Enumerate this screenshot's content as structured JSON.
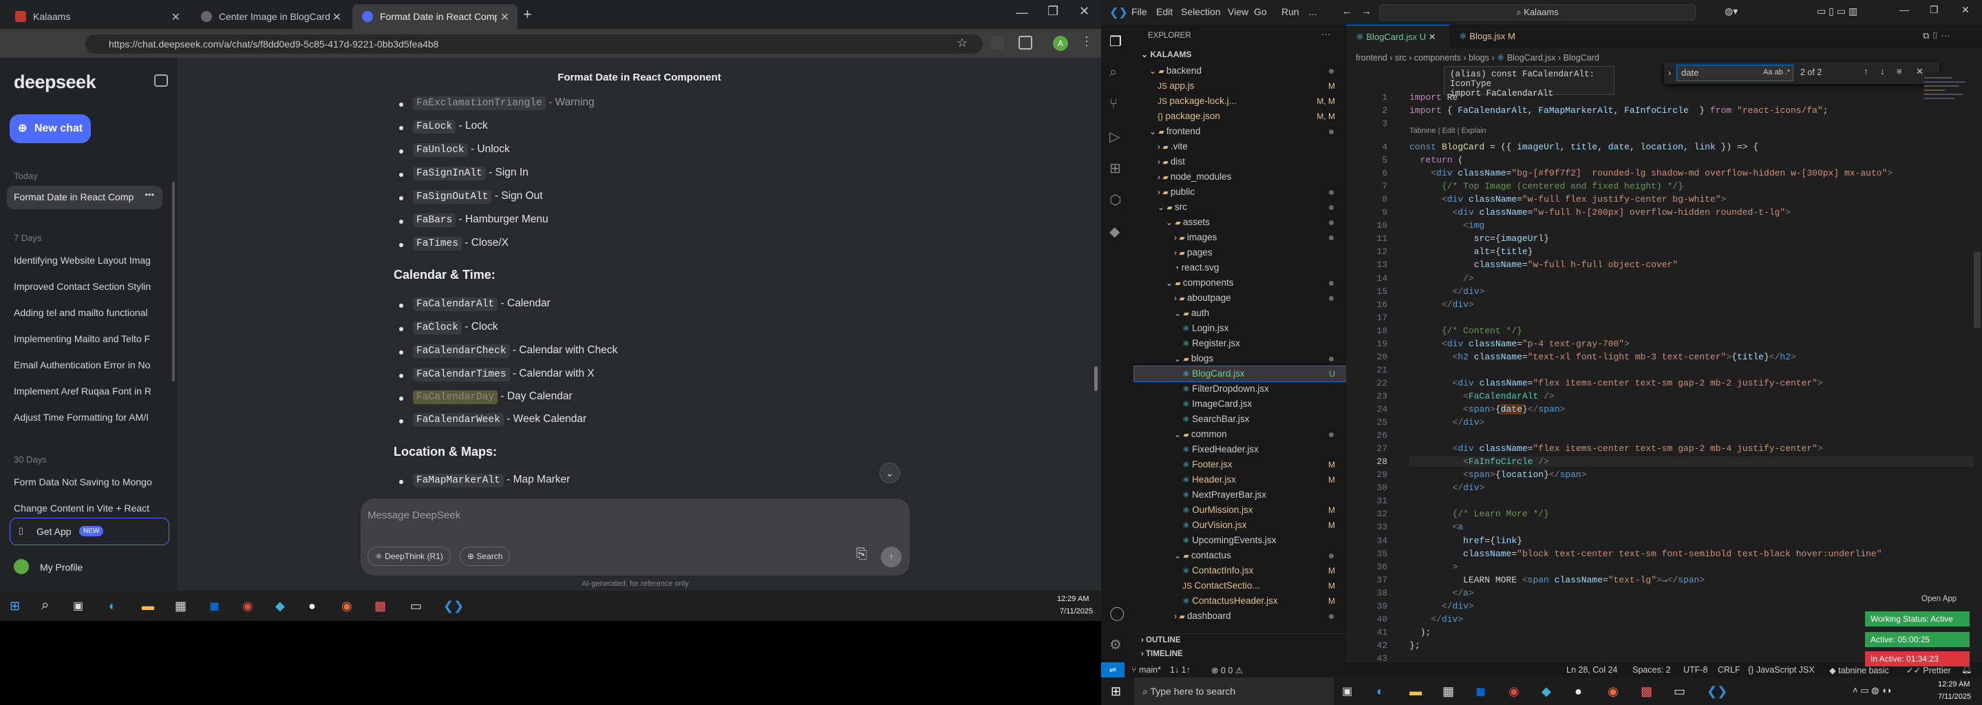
{
  "chrome": {
    "tabs": [
      {
        "title": "Kalaams",
        "active": false
      },
      {
        "title": "Center Image in BlogCard",
        "active": false
      },
      {
        "title": "Format Date in React Compone",
        "active": true
      }
    ],
    "url": "https://chat.deepseek.com/a/chat/s/f8dd0ed9-5c85-417d-9221-0bb3d5fea4b8",
    "profile_initial": "A"
  },
  "deepseek": {
    "logo": "deepseek",
    "new_chat": "New chat",
    "today_label": "Today",
    "today_item": "Format Date in React Comp",
    "seven_days_label": "7 Days",
    "seven_days_items": [
      "Identifying Website Layout Imag",
      "Improved Contact Section Stylin",
      "Adding tel and mailto functional",
      "Implementing Mailto and Telto F",
      "Email Authentication Error in No",
      "Implement Aref Ruqaa Font in R",
      "Adjust Time Formatting for AM/I"
    ],
    "thirty_days_label": "30 Days",
    "thirty_days_items": [
      "Form Data Not Saving to Mongo",
      "Change Content in Vite + React"
    ],
    "get_app": "Get App",
    "new_badge": "NEW",
    "profile": "My Profile",
    "chat_title": "Format Date in React Component",
    "list1": [
      {
        "code": "FaExclamationTriangle",
        "desc": " - Warning"
      },
      {
        "code": "FaLock",
        "desc": " - Lock"
      },
      {
        "code": "FaUnlock",
        "desc": " - Unlock"
      },
      {
        "code": "FaSignInAlt",
        "desc": " - Sign In"
      },
      {
        "code": "FaSignOutAlt",
        "desc": " - Sign Out"
      },
      {
        "code": "FaBars",
        "desc": " - Hamburger Menu"
      },
      {
        "code": "FaTimes",
        "desc": " - Close/X"
      }
    ],
    "heading_calendar": "Calendar & Time:",
    "list2": [
      {
        "code": "FaCalendarAlt",
        "desc": " - Calendar"
      },
      {
        "code": "FaClock",
        "desc": " - Clock"
      },
      {
        "code": "FaCalendarCheck",
        "desc": " - Calendar with Check"
      },
      {
        "code": "FaCalendarTimes",
        "desc": " - Calendar with X"
      },
      {
        "code": "FaCalendarDay",
        "desc": " - Day Calendar"
      },
      {
        "code": "FaCalendarWeek",
        "desc": " - Week Calendar"
      }
    ],
    "heading_location": "Location & Maps:",
    "list3": [
      {
        "code": "FaMapMarkerAlt",
        "desc": " - Map Marker"
      }
    ],
    "input_placeholder": "Message DeepSeek",
    "deepthink": "DeepThink (R1)",
    "search": "Search",
    "disclaimer": "AI-generated, for reference only"
  },
  "taskbar_left": {
    "time": "12:29 AM",
    "date": "7/11/2025"
  },
  "vscode": {
    "menu": [
      "File",
      "Edit",
      "Selection",
      "View",
      "Go",
      "Run",
      "..."
    ],
    "search": "Kalaams",
    "explorer_title": "EXPLORER",
    "root": "KALAAMS",
    "tree": [
      {
        "name": "backend",
        "type": "folder",
        "depth": 0,
        "open": true,
        "status": "dot"
      },
      {
        "name": "app.js",
        "type": "file",
        "depth": 1,
        "status": "M"
      },
      {
        "name": "package-lock.j...",
        "type": "file",
        "depth": 1,
        "status": "M, M"
      },
      {
        "name": "package.json",
        "type": "file",
        "depth": 1,
        "status": "M, M"
      },
      {
        "name": "frontend",
        "type": "folder",
        "depth": 0,
        "open": true,
        "status": "dot"
      },
      {
        "name": ".vite",
        "type": "folder",
        "depth": 1,
        "open": false,
        "status": ""
      },
      {
        "name": "dist",
        "type": "folder",
        "depth": 1,
        "open": false,
        "status": ""
      },
      {
        "name": "node_modules",
        "type": "folder",
        "depth": 1,
        "open": false,
        "status": ""
      },
      {
        "name": "public",
        "type": "folder",
        "depth": 1,
        "open": false,
        "status": "dot"
      },
      {
        "name": "src",
        "type": "folder",
        "depth": 1,
        "open": true,
        "status": "dot"
      },
      {
        "name": "assets",
        "type": "folder",
        "depth": 2,
        "open": true,
        "status": "dot"
      },
      {
        "name": "images",
        "type": "folder",
        "depth": 3,
        "open": false,
        "status": "dot"
      },
      {
        "name": "pages",
        "type": "folder",
        "depth": 3,
        "open": false,
        "status": ""
      },
      {
        "name": "react.svg",
        "type": "file",
        "depth": 3,
        "status": ""
      },
      {
        "name": "components",
        "type": "folder",
        "depth": 2,
        "open": true,
        "status": "dot"
      },
      {
        "name": "aboutpage",
        "type": "folder",
        "depth": 3,
        "open": false,
        "status": "dot"
      },
      {
        "name": "auth",
        "type": "folder",
        "depth": 3,
        "open": true,
        "status": ""
      },
      {
        "name": "Login.jsx",
        "type": "file",
        "depth": 4,
        "status": ""
      },
      {
        "name": "Register.jsx",
        "type": "file",
        "depth": 4,
        "status": ""
      },
      {
        "name": "blogs",
        "type": "folder",
        "depth": 3,
        "open": true,
        "status": "dot"
      },
      {
        "name": "BlogCard.jsx",
        "type": "file",
        "depth": 4,
        "status": "U",
        "selected": true
      },
      {
        "name": "FilterDropdown.jsx",
        "type": "file",
        "depth": 4,
        "status": ""
      },
      {
        "name": "ImageCard.jsx",
        "type": "file",
        "depth": 4,
        "status": ""
      },
      {
        "name": "SearchBar.jsx",
        "type": "file",
        "depth": 4,
        "status": ""
      },
      {
        "name": "common",
        "type": "folder",
        "depth": 3,
        "open": true,
        "status": "dot"
      },
      {
        "name": "FixedHeader.jsx",
        "type": "file",
        "depth": 4,
        "status": ""
      },
      {
        "name": "Footer.jsx",
        "type": "file",
        "depth": 4,
        "status": "M"
      },
      {
        "name": "Header.jsx",
        "type": "file",
        "depth": 4,
        "status": "M"
      },
      {
        "name": "NextPrayerBar.jsx",
        "type": "file",
        "depth": 4,
        "status": ""
      },
      {
        "name": "OurMission.jsx",
        "type": "file",
        "depth": 4,
        "status": "M"
      },
      {
        "name": "OurVision.jsx",
        "type": "file",
        "depth": 4,
        "status": "M"
      },
      {
        "name": "UpcomingEvents.jsx",
        "type": "file",
        "depth": 4,
        "status": ""
      },
      {
        "name": "contactus",
        "type": "folder",
        "depth": 3,
        "open": true,
        "status": "dot"
      },
      {
        "name": "ContactInfo.jsx",
        "type": "file",
        "depth": 4,
        "status": "M"
      },
      {
        "name": "ContactSectio...",
        "type": "file",
        "depth": 4,
        "status": "M"
      },
      {
        "name": "ContactusHeader.jsx",
        "type": "file",
        "depth": 4,
        "status": "M"
      },
      {
        "name": "dashboard",
        "type": "folder",
        "depth": 3,
        "open": false,
        "status": "dot"
      }
    ],
    "outline": "OUTLINE",
    "timeline": "TIMELINE",
    "tabs": [
      {
        "name": "BlogCard.jsx",
        "status": "U",
        "active": true
      },
      {
        "name": "Blogs.jsx",
        "status": "M",
        "active": false
      }
    ],
    "breadcrumb": [
      "frontend",
      "src",
      "components",
      "blogs",
      "BlogCard.jsx",
      "BlogCard"
    ],
    "find": {
      "query": "date",
      "count": "2 of 2"
    },
    "hover": {
      "line1": "(alias) const FaCalendarAlt: IconType",
      "line2": "import FaCalendarAlt"
    },
    "codelens": "Tabnine | Edit | Explain",
    "statusbar": {
      "branch": "main*",
      "sync": "1↓ 1↑",
      "problems": "0  0",
      "position": "Ln 28, Col 24",
      "spaces": "Spaces: 2",
      "encoding": "UTF-8",
      "eol": "CRLF",
      "language": "JavaScript JSX",
      "tabnine": "tabnine basic",
      "prettier": "Prettier"
    },
    "open_app": "Open App",
    "working_status": "Working Status: Active",
    "active_time": "Active: 05:00:25",
    "inactive_time": "In Active: 01:34:23"
  },
  "taskbar_right": {
    "search_placeholder": "Type here to search",
    "time": "12:29 AM",
    "date": "7/11/2025"
  }
}
